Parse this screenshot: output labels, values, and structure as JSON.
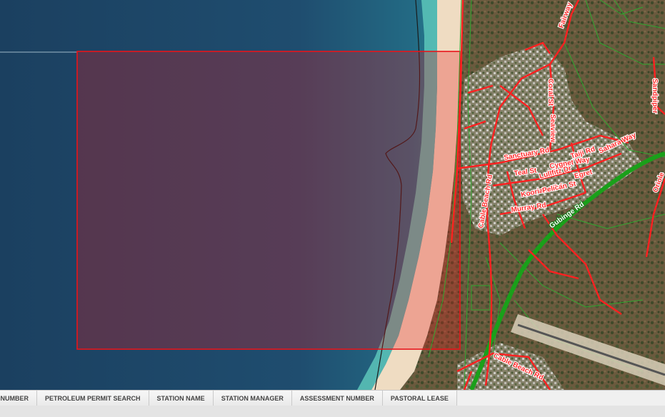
{
  "map": {
    "colors": {
      "road": "#ff2020",
      "highway": "#1aa01a",
      "boundary": "#2fa82f",
      "selection": "#e8141a",
      "ocean_deep": "#1d4a6e",
      "ocean_shallow": "#2fa8a8",
      "beach": "#f0dcc0"
    },
    "labels": {
      "sanctuary": "Sanctuary Rd",
      "gubinge": "Gubinge Rd",
      "murray": "Murray Rd",
      "kooriana": "Kooriana Rd",
      "cable_beach_north": "Cable Beach Rd",
      "cable_beach_south": "Cable Beach Rd",
      "corel": "Coral St",
      "seaview": "Seaview",
      "sandpiper": "Sandpiper",
      "lullfitz": "Lullfitz Dr",
      "fairway": "Fairway",
      "taiji": "Taiji Rd",
      "sahara": "Sahara Way",
      "cygnet": "Cygnet Way",
      "teal": "Teal St",
      "pelican": "Pelican St",
      "egret": "Egret",
      "oriole": "Oriole"
    }
  },
  "tabs": [
    {
      "label": "NT NUMBER"
    },
    {
      "label": "PETROLEUM PERMIT SEARCH"
    },
    {
      "label": "STATION NAME"
    },
    {
      "label": "STATION MANAGER"
    },
    {
      "label": "ASSESSMENT NUMBER"
    },
    {
      "label": "PASTORAL LEASE"
    }
  ]
}
